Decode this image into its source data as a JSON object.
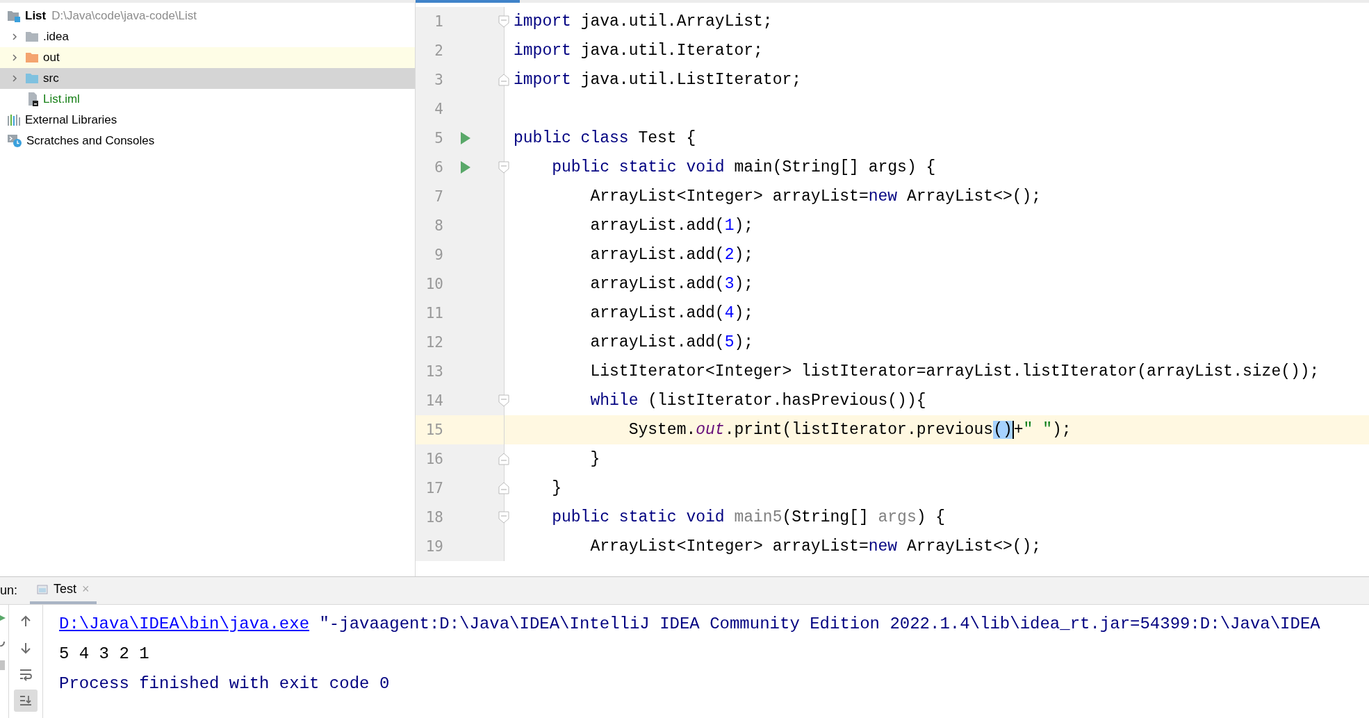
{
  "project_tree": {
    "items": [
      {
        "kind": "project",
        "label": "List",
        "path": "D:\\Java\\code\\java-code\\List",
        "selected": false,
        "highlighted": false,
        "children": [
          {
            "kind": "folder",
            "label": ".idea",
            "color": "#aeb5bc",
            "expanded": false,
            "selected": false,
            "highlighted": false
          },
          {
            "kind": "folder",
            "label": "out",
            "color": "#f4a46f",
            "expanded": false,
            "selected": false,
            "highlighted": true
          },
          {
            "kind": "folder",
            "label": "src",
            "color": "#7fc1df",
            "expanded": false,
            "selected": true,
            "highlighted": false
          },
          {
            "kind": "file",
            "label": "List.iml",
            "selected": false,
            "highlighted": false
          }
        ]
      },
      {
        "kind": "libraries",
        "label": "External Libraries",
        "selected": false,
        "highlighted": false
      },
      {
        "kind": "scratches",
        "label": "Scratches and Consoles",
        "selected": false,
        "highlighted": false
      }
    ]
  },
  "editor": {
    "lines": [
      {
        "number": "1",
        "fold": {
          "kind": "start"
        },
        "run": false,
        "current": false,
        "tokens": [
          {
            "kind": "keyword",
            "text": "import"
          },
          {
            "kind": "plain",
            "text": " java.util.ArrayList;"
          }
        ]
      },
      {
        "number": "2",
        "run": false,
        "current": false,
        "tokens": [
          {
            "kind": "keyword",
            "text": "import"
          },
          {
            "kind": "plain",
            "text": " java.util.Iterator;"
          }
        ]
      },
      {
        "number": "3",
        "fold": {
          "kind": "end"
        },
        "run": false,
        "current": false,
        "tokens": [
          {
            "kind": "keyword",
            "text": "import"
          },
          {
            "kind": "plain",
            "text": " java.util.ListIterator;"
          }
        ]
      },
      {
        "number": "4",
        "run": false,
        "current": false
      },
      {
        "number": "5",
        "run": true,
        "current": false,
        "tokens": [
          {
            "kind": "keyword",
            "text": "public class"
          },
          {
            "kind": "plain",
            "text": " Test {"
          }
        ]
      },
      {
        "number": "6",
        "fold": {
          "kind": "start"
        },
        "run": true,
        "current": false,
        "tokens": [
          {
            "kind": "keyword",
            "text": "    public static void"
          },
          {
            "kind": "plain",
            "text": " main(String[] args) {"
          }
        ]
      },
      {
        "number": "7",
        "run": false,
        "current": false,
        "tokens": [
          {
            "kind": "plain",
            "text": "        ArrayList<Integer> arrayList="
          },
          {
            "kind": "keyword",
            "text": "new"
          },
          {
            "kind": "plain",
            "text": " ArrayList<>();"
          }
        ]
      },
      {
        "number": "8",
        "run": false,
        "current": false,
        "tokens": [
          {
            "kind": "plain",
            "text": "        arrayList.add("
          },
          {
            "kind": "number",
            "text": "1"
          },
          {
            "kind": "plain",
            "text": ");"
          }
        ]
      },
      {
        "number": "9",
        "run": false,
        "current": false,
        "tokens": [
          {
            "kind": "plain",
            "text": "        arrayList.add("
          },
          {
            "kind": "number",
            "text": "2"
          },
          {
            "kind": "plain",
            "text": ");"
          }
        ]
      },
      {
        "number": "10",
        "run": false,
        "current": false,
        "tokens": [
          {
            "kind": "plain",
            "text": "        arrayList.add("
          },
          {
            "kind": "number",
            "text": "3"
          },
          {
            "kind": "plain",
            "text": ");"
          }
        ]
      },
      {
        "number": "11",
        "run": false,
        "current": false,
        "tokens": [
          {
            "kind": "plain",
            "text": "        arrayList.add("
          },
          {
            "kind": "number",
            "text": "4"
          },
          {
            "kind": "plain",
            "text": ");"
          }
        ]
      },
      {
        "number": "12",
        "run": false,
        "current": false,
        "tokens": [
          {
            "kind": "plain",
            "text": "        arrayList.add("
          },
          {
            "kind": "number",
            "text": "5"
          },
          {
            "kind": "plain",
            "text": ");"
          }
        ]
      },
      {
        "number": "13",
        "run": false,
        "current": false,
        "tokens": [
          {
            "kind": "plain",
            "text": "        ListIterator<Integer> listIterator=arrayList.listIterator(arrayList.size());"
          }
        ]
      },
      {
        "number": "14",
        "fold": {
          "kind": "start"
        },
        "run": false,
        "current": false,
        "tokens": [
          {
            "kind": "keyword",
            "text": "        while"
          },
          {
            "kind": "plain",
            "text": " (listIterator.hasPrevious()){"
          }
        ]
      },
      {
        "number": "15",
        "run": false,
        "current": true,
        "tokens": [
          {
            "kind": "plain",
            "text": "            System."
          },
          {
            "kind": "static",
            "text": "out"
          },
          {
            "kind": "plain",
            "text": ".print(listIterator.previous"
          },
          {
            "kind": "selection",
            "text": "()"
          },
          {
            "kind": "plain",
            "text": "+",
            "caret": true
          },
          {
            "kind": "string",
            "text": "\" \""
          },
          {
            "kind": "plain",
            "text": ");"
          }
        ]
      },
      {
        "number": "16",
        "fold": {
          "kind": "end"
        },
        "run": false,
        "current": false,
        "tokens": [
          {
            "kind": "plain",
            "text": "        }"
          }
        ]
      },
      {
        "number": "17",
        "fold": {
          "kind": "end"
        },
        "run": false,
        "current": false,
        "tokens": [
          {
            "kind": "plain",
            "text": "    }"
          }
        ]
      },
      {
        "number": "18",
        "fold": {
          "kind": "start"
        },
        "run": false,
        "current": false,
        "tokens": [
          {
            "kind": "keyword",
            "text": "    public static void"
          },
          {
            "kind": "unused",
            "text": " main5"
          },
          {
            "kind": "plain",
            "text": "(String[] "
          },
          {
            "kind": "unused",
            "text": "args"
          },
          {
            "kind": "plain",
            "text": ") {"
          }
        ]
      },
      {
        "number": "19",
        "run": false,
        "current": false,
        "tokens": [
          {
            "kind": "plain",
            "text": "        ArrayList<Integer> arrayList="
          },
          {
            "kind": "keyword",
            "text": "new"
          },
          {
            "kind": "plain",
            "text": " ArrayList<>();"
          }
        ]
      }
    ]
  },
  "run_panel": {
    "label": "un:",
    "tabs": [
      {
        "label": "Test",
        "selected": true,
        "close": "×"
      }
    ],
    "toolbar": [
      {
        "kind": "up",
        "on": false
      },
      {
        "kind": "down",
        "on": false
      },
      {
        "kind": "wrap",
        "on": false
      },
      {
        "kind": "scroll-end",
        "on": true
      }
    ],
    "console": [
      {
        "tokens": [
          {
            "kind": "link",
            "text": "D:\\Java\\IDEA\\bin\\java.exe"
          },
          {
            "kind": "system",
            "text": " \"-javaagent:D:\\Java\\IDEA\\IntelliJ IDEA Community Edition 2022.1.4\\lib\\idea_rt.jar=54399:D:\\Java\\IDEA"
          }
        ]
      },
      {
        "tokens": [
          {
            "kind": "output",
            "text": "5 4 3 2 1"
          }
        ]
      },
      {
        "tokens": [
          {
            "kind": "system",
            "text": "Process finished with exit code 0"
          }
        ]
      }
    ]
  }
}
